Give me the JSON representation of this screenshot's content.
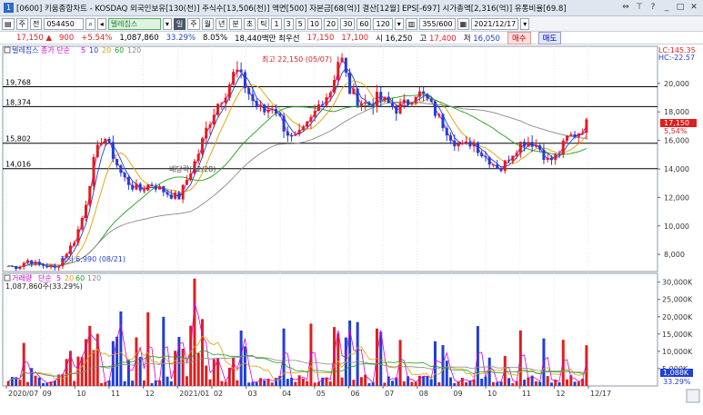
{
  "window": {
    "title": "[0600] 키움종합차트 - KOSDAQ 외국인보유[130(천)] 주식수[13,506(천)] 액면[500] 자본금[68(억)] 결산[12월] EPS[-697] 시가총액[2,316(억)] 유통비율[69.8]",
    "icon_label": "1"
  },
  "toolbar": {
    "mode": "주",
    "scope": "전",
    "code": "054450",
    "name": "텔레칩스",
    "periods": [
      "주",
      "월",
      "년",
      "분",
      "초",
      "틱"
    ],
    "intervals": [
      "1",
      "3",
      "5",
      "10",
      "20",
      "30",
      "60",
      "120"
    ],
    "count": "355",
    "count_total": "/600",
    "date": "2021/12/17"
  },
  "quote": {
    "price": "17,150",
    "arrow": "▲",
    "change": "900",
    "change_pct": "+5.54%",
    "volume": "1,087,860",
    "vol_ratio": "33.29%",
    "turnover": "8.05%",
    "value": "18,440백만",
    "best_ask_label": "최우선",
    "best_ask": "17,150",
    "best_bid": "17,100",
    "open_label": "시",
    "open": "16,250",
    "high_label": "고",
    "high": "17,400",
    "low_label": "저",
    "low": "16,050",
    "buy": "매수",
    "sell": "매도"
  },
  "price_panel": {
    "legend_name": "텔레칩스",
    "legend_ma": "종가 단순",
    "ma_periods": [
      "5",
      "10",
      "20",
      "60",
      "120"
    ],
    "ma_colors": [
      "#d400d4",
      "#1f3fd6",
      "#e0a000",
      "#1ea01e",
      "#888888"
    ],
    "lc": "LC:145.35",
    "hc": "HC:-22.57",
    "high_annotation": "최고 22,150 (05/07)",
    "low_annotation": "최저 6,990 (08/21)",
    "dividend_annotation": "배당락(12/28)",
    "hlines": [
      {
        "label": "19,768",
        "value": 19768
      },
      {
        "label": "18,374",
        "value": 18374
      },
      {
        "label": "15,802",
        "value": 15802
      },
      {
        "label": "14,016",
        "value": 14016
      }
    ],
    "yticks": [
      "20,000",
      "18,000",
      "16,000",
      "14,000",
      "12,000",
      "10,000",
      "8,000"
    ],
    "last_price_tag": "17,150",
    "last_pct_tag": "5,54%"
  },
  "volume_panel": {
    "legend_name": "거래량",
    "legend_ma": "단순",
    "ma_periods": [
      "5",
      "20",
      "60",
      "120"
    ],
    "ma_colors": [
      "#d400d4",
      "#e0a000",
      "#1ea01e",
      "#888888"
    ],
    "current": "1,087,860주(33.29%)",
    "yticks": [
      "30,000K",
      "25,000K",
      "20,000K",
      "15,000K",
      "10,000K",
      "5,000K"
    ],
    "last_vol_tag": "1,088K",
    "last_pct_tag": "33.29%"
  },
  "xaxis": {
    "labels": [
      "2020/07",
      "09",
      "10",
      "11",
      "12",
      "2021/01",
      "02",
      "03",
      "04",
      "05",
      "06",
      "07",
      "08",
      "09",
      "10",
      "11",
      "12",
      "12/17"
    ]
  },
  "colors": {
    "up": "#e01e1e",
    "down": "#1f3fd6",
    "panel_border": "#8e99a8"
  },
  "chart_data": {
    "type": "candlestick",
    "price_ylim": [
      6800,
      22600
    ],
    "volume_ylim": [
      0,
      32000000
    ],
    "months": [
      "2020/07",
      "08",
      "09",
      "10",
      "11",
      "12",
      "2021/01",
      "02",
      "03",
      "04",
      "05",
      "06",
      "07",
      "08",
      "09",
      "10",
      "11",
      "12"
    ],
    "close_path": [
      7200,
      7100,
      7600,
      7300,
      7200,
      7000,
      8000,
      9000,
      11000,
      14500,
      16500,
      15000,
      13500,
      12800,
      12500,
      13000,
      12600,
      12200,
      12000,
      13500,
      15000,
      17000,
      18500,
      19500,
      21000,
      19800,
      18500,
      18000,
      18500,
      17000,
      16000,
      16500,
      17500,
      18800,
      19500,
      22150,
      19500,
      18800,
      18500,
      19000,
      18600,
      18200,
      18600,
      19400,
      19000,
      18000,
      17000,
      16000,
      15500,
      16000,
      15000,
      14500,
      14000,
      15000,
      15800,
      16000,
      15500,
      14500,
      15000,
      16200,
      16500,
      17150
    ]
  }
}
